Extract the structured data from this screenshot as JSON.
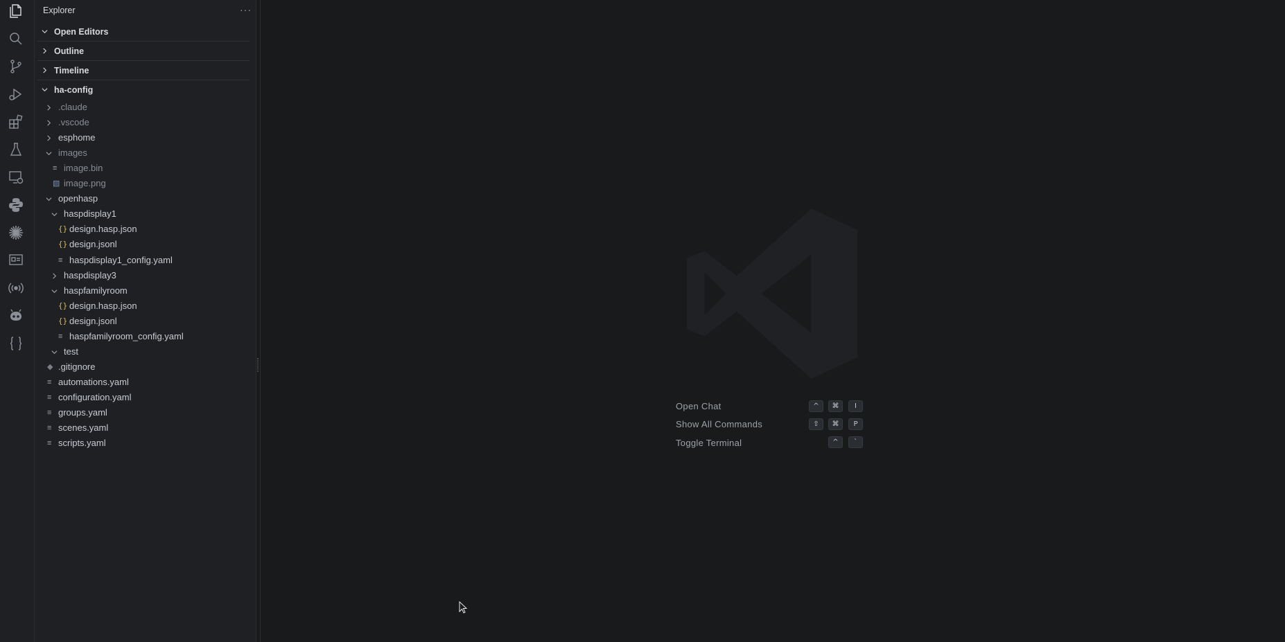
{
  "activity_bar": {
    "icons": [
      "explorer-icon",
      "search-icon",
      "source-control-icon",
      "run-debug-icon",
      "extensions-icon",
      "testing-icon",
      "remote-explorer-icon",
      "python-icon",
      "claude-icon",
      "remote-display-icon",
      "broadcast-icon",
      "platformio-icon",
      "json-icon"
    ]
  },
  "sidebar": {
    "title": "Explorer",
    "more": "···",
    "sections": {
      "open_editors": "Open Editors",
      "outline": "Outline",
      "timeline": "Timeline",
      "workspace": "ha-config"
    },
    "tree": [
      {
        "label": ".claude",
        "kind": "folder",
        "expanded": false,
        "depth": 0,
        "dim": true
      },
      {
        "label": ".vscode",
        "kind": "folder",
        "expanded": false,
        "depth": 0,
        "dim": true
      },
      {
        "label": "esphome",
        "kind": "folder",
        "expanded": false,
        "depth": 0,
        "dim": false
      },
      {
        "label": "images",
        "kind": "folder",
        "expanded": true,
        "depth": 0,
        "dim": true
      },
      {
        "label": "image.bin",
        "kind": "file-lines",
        "depth": 1,
        "dim": true
      },
      {
        "label": "image.png",
        "kind": "file-image",
        "depth": 1,
        "dim": true
      },
      {
        "label": "openhasp",
        "kind": "folder",
        "expanded": true,
        "depth": 0,
        "dim": false
      },
      {
        "label": "haspdisplay1",
        "kind": "folder",
        "expanded": true,
        "depth": 1,
        "dim": false
      },
      {
        "label": "design.hasp.json",
        "kind": "file-json",
        "depth": 2,
        "dim": false
      },
      {
        "label": "design.jsonl",
        "kind": "file-json",
        "depth": 2,
        "dim": false
      },
      {
        "label": "haspdisplay1_config.yaml",
        "kind": "file-lines",
        "depth": 2,
        "dim": false
      },
      {
        "label": "haspdisplay3",
        "kind": "folder",
        "expanded": false,
        "depth": 1,
        "dim": false
      },
      {
        "label": "haspfamilyroom",
        "kind": "folder",
        "expanded": true,
        "depth": 1,
        "dim": false
      },
      {
        "label": "design.hasp.json",
        "kind": "file-json",
        "depth": 2,
        "dim": false
      },
      {
        "label": "design.jsonl",
        "kind": "file-json",
        "depth": 2,
        "dim": false
      },
      {
        "label": "haspfamilyroom_config.yaml",
        "kind": "file-lines",
        "depth": 2,
        "dim": false
      },
      {
        "label": "test",
        "kind": "folder",
        "expanded": true,
        "depth": 1,
        "dim": false
      },
      {
        "label": ".gitignore",
        "kind": "file-git",
        "depth": 0,
        "dim": false
      },
      {
        "label": "automations.yaml",
        "kind": "file-lines",
        "depth": 0,
        "dim": false
      },
      {
        "label": "configuration.yaml",
        "kind": "file-lines",
        "depth": 0,
        "dim": false
      },
      {
        "label": "groups.yaml",
        "kind": "file-lines",
        "depth": 0,
        "dim": false
      },
      {
        "label": "scenes.yaml",
        "kind": "file-lines",
        "depth": 0,
        "dim": false
      },
      {
        "label": "scripts.yaml",
        "kind": "file-lines",
        "depth": 0,
        "dim": false
      }
    ]
  },
  "editor": {
    "watermark": "vscode-logo-icon",
    "hints": [
      {
        "label": "Open Chat",
        "keys": [
          "^",
          "⌘",
          "I"
        ]
      },
      {
        "label": "Show All Commands",
        "keys": [
          "⇧",
          "⌘",
          "P"
        ]
      },
      {
        "label": "Toggle Terminal",
        "keys": [
          "^",
          "`"
        ]
      }
    ]
  },
  "colors": {
    "accent_json": "#e2b93d",
    "background": "#181a1c",
    "sidebar": "#1e2023"
  }
}
